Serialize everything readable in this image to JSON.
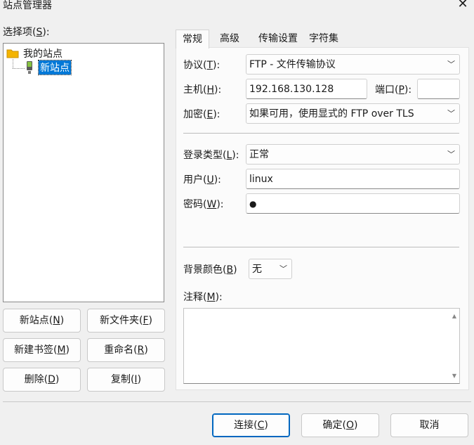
{
  "window": {
    "title": "站点管理器",
    "close_glyph": "✕"
  },
  "left": {
    "label": "选择项(S):",
    "tree": {
      "root": "我的站点",
      "site": "新站点"
    },
    "buttons": {
      "new_site": "新站点(N)",
      "new_folder": "新文件夹(F)",
      "new_bookmark": "新建书签(M)",
      "rename": "重命名(R)",
      "delete": "删除(D)",
      "copy": "复制(I)"
    }
  },
  "tabs": [
    "常规",
    "高级",
    "传输设置",
    "字符集"
  ],
  "general": {
    "protocol_label": "协议(T):",
    "protocol_value": "FTP - 文件传输协议",
    "host_label": "主机(H):",
    "host_value": "192.168.130.128",
    "port_label": "端口(P):",
    "port_value": "",
    "encryption_label": "加密(E):",
    "encryption_value": "如果可用，使用显式的 FTP over TLS",
    "logon_type_label": "登录类型(L):",
    "logon_type_value": "正常",
    "user_label": "用户(U):",
    "user_value": "linux",
    "password_label": "密码(W):",
    "password_value": "●",
    "bg_color_label": "背景颜色(B)",
    "bg_color_value": "无",
    "comments_label": "注释(M):"
  },
  "footer": {
    "connect": "连接(C)",
    "ok": "确定(O)",
    "cancel": "取消"
  },
  "colors": {
    "selection": "#0078d7",
    "accent_border": "#0067c0",
    "folder": "#f4b400"
  },
  "icons": [
    "folder-icon",
    "site-icon",
    "chevron-down-icon",
    "close-icon"
  ]
}
